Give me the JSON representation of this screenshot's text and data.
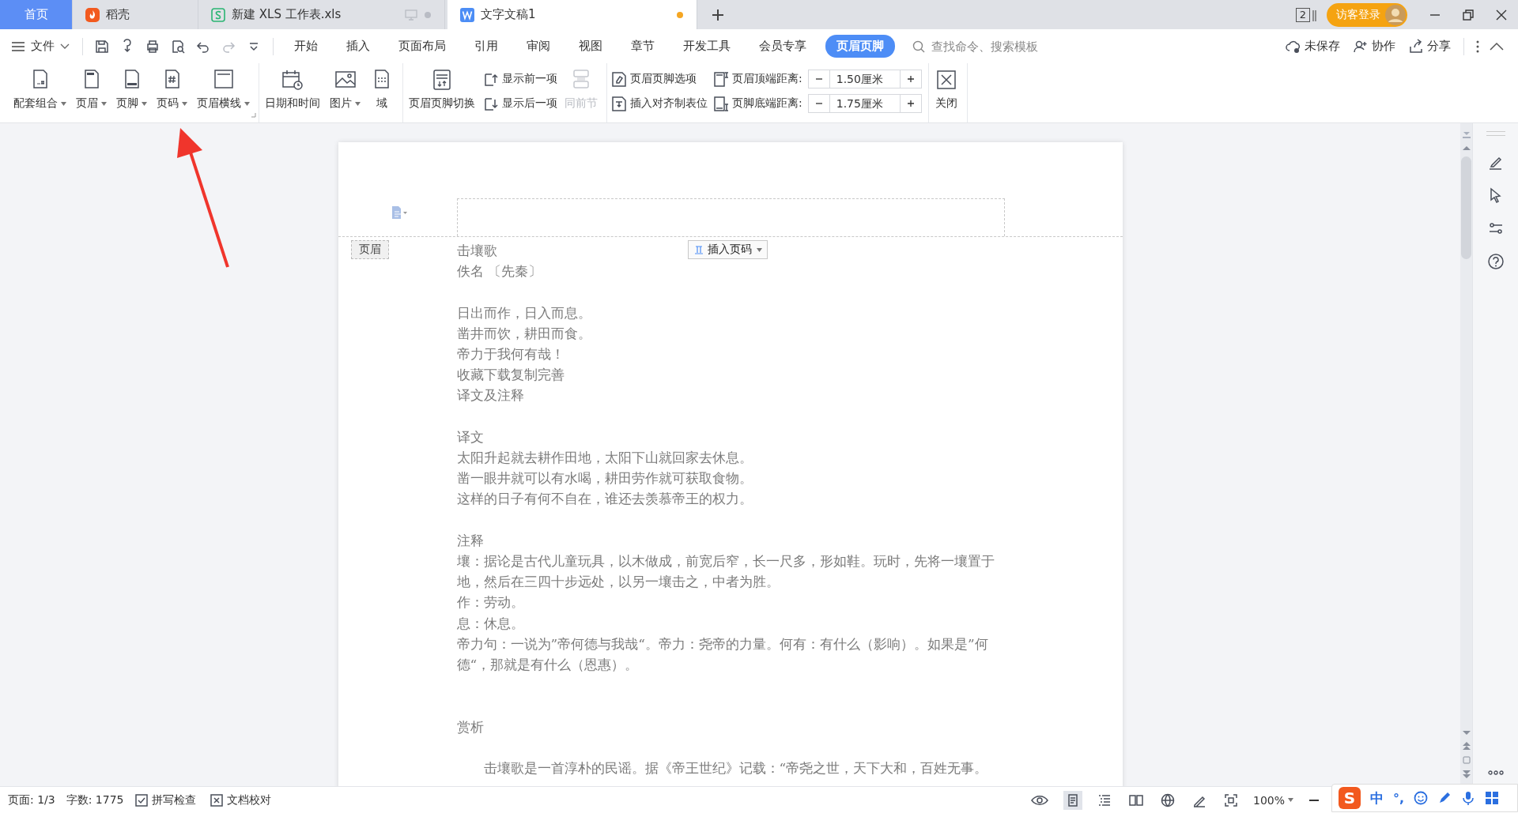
{
  "tabs": [
    {
      "label": "首页",
      "kind": "home",
      "selected": false,
      "unsaved": false
    },
    {
      "label": "稻壳",
      "kind": "docer",
      "selected": false,
      "unsaved": false
    },
    {
      "label": "新建 XLS 工作表.xls",
      "kind": "sheet",
      "selected": false,
      "unsaved": false
    },
    {
      "label": "文字文稿1",
      "kind": "writer",
      "selected": true,
      "unsaved": true
    }
  ],
  "title_bar": {
    "window_count": "2",
    "login": "访客登录"
  },
  "menu_bar": {
    "file": "文件",
    "menus": [
      {
        "label": "开始",
        "selected": false
      },
      {
        "label": "插入",
        "selected": false
      },
      {
        "label": "页面布局",
        "selected": false
      },
      {
        "label": "引用",
        "selected": false
      },
      {
        "label": "审阅",
        "selected": false
      },
      {
        "label": "视图",
        "selected": false
      },
      {
        "label": "章节",
        "selected": false
      },
      {
        "label": "开发工具",
        "selected": false
      },
      {
        "label": "会员专享",
        "selected": false
      },
      {
        "label": "页眉页脚",
        "selected": true
      }
    ],
    "search": {
      "placeholder": "查找命令、搜索模板"
    },
    "actions": [
      "未保存",
      "协作",
      "分享"
    ]
  },
  "ribbon": {
    "groups": [
      {
        "items": [
          {
            "kind": "large",
            "label": "配套组合",
            "dropdown": true,
            "disabled": false
          },
          {
            "kind": "large",
            "label": "页眉",
            "dropdown": true,
            "disabled": false
          },
          {
            "kind": "large",
            "label": "页脚",
            "dropdown": true,
            "disabled": false
          },
          {
            "kind": "large",
            "label": "页码",
            "dropdown": true,
            "disabled": false
          },
          {
            "kind": "large",
            "label": "页眉横线",
            "dropdown": true,
            "disabled": false
          }
        ]
      },
      {
        "items": [
          {
            "kind": "large",
            "label": "日期和时间",
            "dropdown": false,
            "disabled": false
          },
          {
            "kind": "large",
            "label": "图片",
            "dropdown": true,
            "disabled": false
          },
          {
            "kind": "large",
            "label": "域",
            "dropdown": false,
            "disabled": false
          }
        ]
      },
      {
        "items": [
          {
            "kind": "large",
            "label": "页眉页脚切换",
            "dropdown": false,
            "disabled": false
          },
          {
            "kind": "stack",
            "rows": [
              {
                "label": "显示前一项"
              },
              {
                "label": "显示后一项"
              }
            ]
          },
          {
            "kind": "large",
            "label": "同前节",
            "dropdown": false,
            "disabled": true
          }
        ]
      },
      {
        "items": [
          {
            "kind": "stack",
            "rows": [
              {
                "label": "页眉页脚选项"
              },
              {
                "label": "插入对齐制表位"
              }
            ]
          },
          {
            "kind": "spinners",
            "rows": [
              {
                "label": "页眉顶端距离:",
                "value": "1.50厘米"
              },
              {
                "label": "页脚底端距离:",
                "value": "1.75厘米"
              }
            ]
          }
        ]
      },
      {
        "items": [
          {
            "kind": "large",
            "label": "关闭",
            "dropdown": false,
            "disabled": false
          }
        ]
      }
    ]
  },
  "document": {
    "header_label": "页眉",
    "insert_page_number": "插入页码",
    "lines": [
      {
        "kind": "text",
        "text": "击壤歌"
      },
      {
        "kind": "text",
        "text": "佚名 〔先秦〕"
      },
      {
        "kind": "blank"
      },
      {
        "kind": "text",
        "text": "日出而作，日入而息。"
      },
      {
        "kind": "text",
        "text": "凿井而饮，耕田而食。"
      },
      {
        "kind": "text",
        "text": "帝力于我何有哉！"
      },
      {
        "kind": "text",
        "text": "收藏下载复制完善"
      },
      {
        "kind": "text",
        "text": "译文及注释"
      },
      {
        "kind": "blank"
      },
      {
        "kind": "text",
        "text": "译文"
      },
      {
        "kind": "text",
        "text": "太阳升起就去耕作田地，太阳下山就回家去休息。"
      },
      {
        "kind": "text",
        "text": "凿一眼井就可以有水喝，耕田劳作就可获取食物。"
      },
      {
        "kind": "text",
        "text": "这样的日子有何不自在，谁还去羡慕帝王的权力。"
      },
      {
        "kind": "blank"
      },
      {
        "kind": "text",
        "text": "注释"
      },
      {
        "kind": "text",
        "text": "壤：据论是古代儿童玩具，以木做成，前宽后窄，长一尺多，形如鞋。玩时，先将一壤置于地，然后在三四十步远处，以另一壤击之，中者为胜。"
      },
      {
        "kind": "text",
        "text": "作：劳动。"
      },
      {
        "kind": "text",
        "text": "息：休息。"
      },
      {
        "kind": "text",
        "text": "帝力句：一说为”帝何德与我哉“。帝力：尧帝的力量。何有：有什么（影响）。如果是”何德“，那就是有什么（恩惠）。"
      },
      {
        "kind": "blank"
      },
      {
        "kind": "blank"
      },
      {
        "kind": "text",
        "text": "赏析"
      },
      {
        "kind": "blank"
      },
      {
        "kind": "indent",
        "text": "击壤歌是一首淳朴的民谣。据《帝王世纪》记载：“帝尧之世，天下大和，百姓无事。"
      }
    ]
  },
  "status_bar": {
    "page": "页面: 1/3",
    "words": "字数: 1775",
    "tools": [
      "拼写检查",
      "文档校对"
    ],
    "views": [
      {
        "selected": true
      },
      {
        "selected": false
      },
      {
        "selected": false
      },
      {
        "selected": false
      },
      {
        "selected": false
      }
    ],
    "zoom": "100%"
  },
  "ime": {
    "logo": "S",
    "mode": "中",
    "punct": "°,"
  }
}
